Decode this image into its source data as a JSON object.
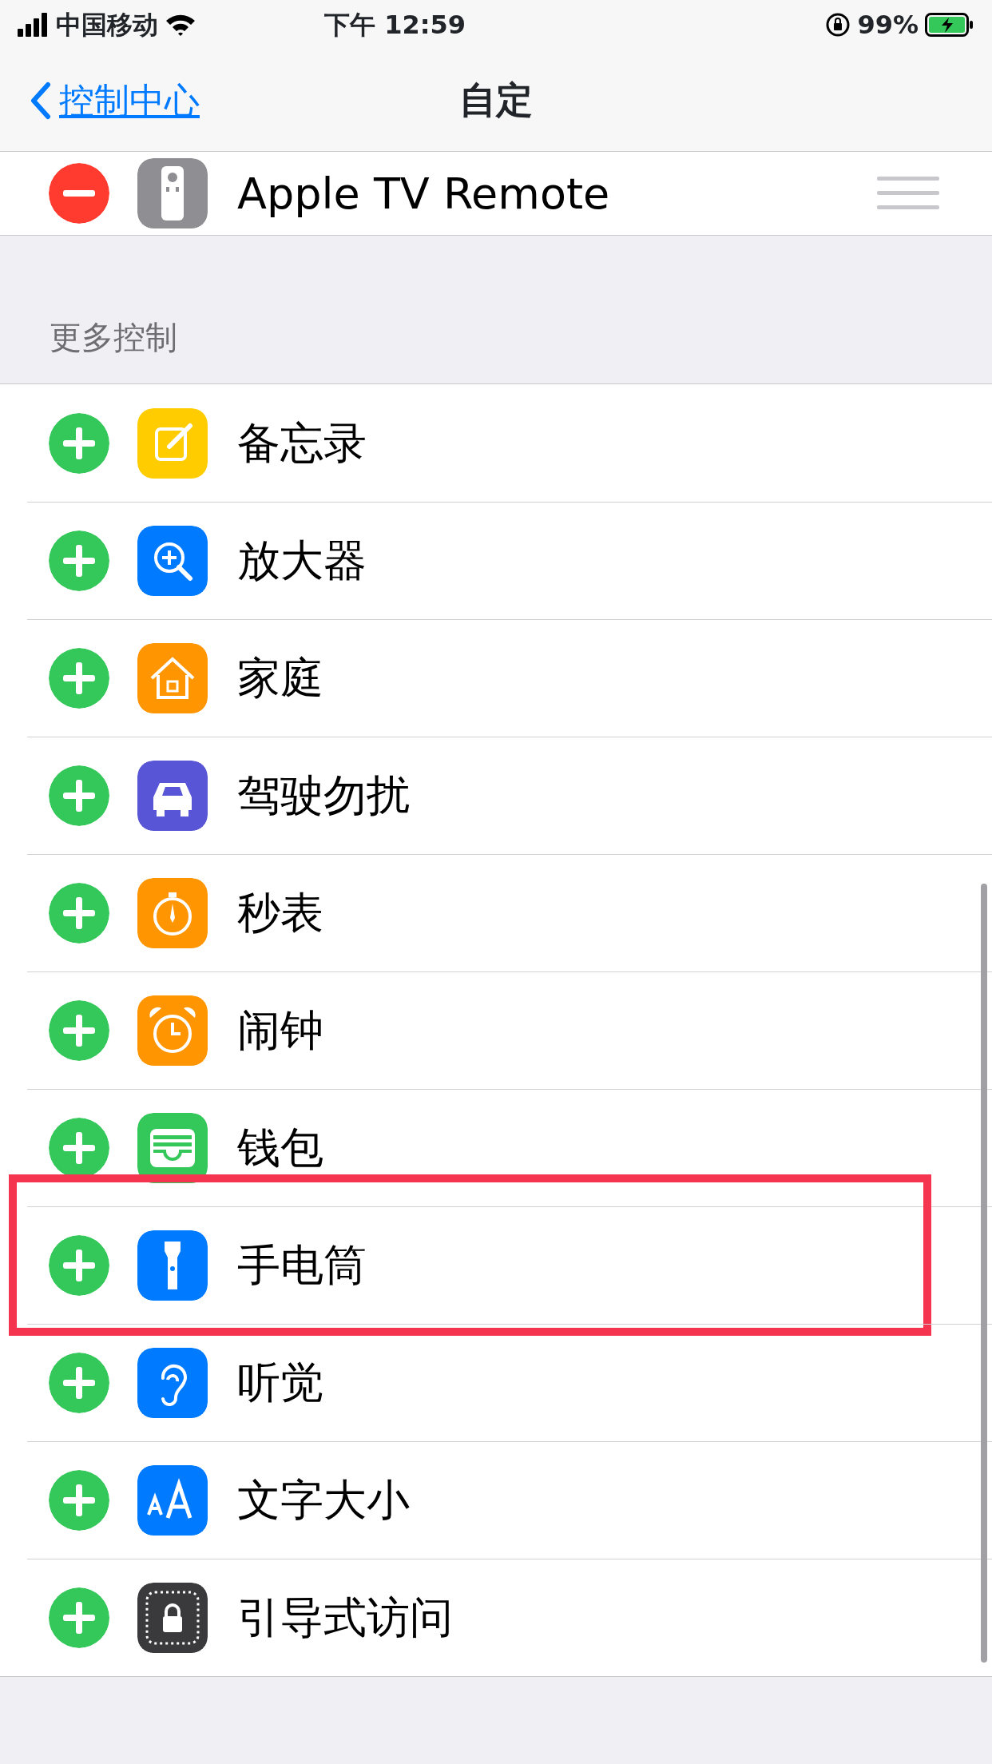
{
  "status_bar": {
    "carrier": "中国移动",
    "time": "下午 12:59",
    "battery": "99%"
  },
  "nav": {
    "back": "控制中心",
    "title": "自定"
  },
  "included": [
    {
      "label": "Apple TV Remote",
      "color": "#8e8e93"
    }
  ],
  "section_header": "更多控制",
  "more": [
    {
      "label": "备忘录",
      "color": "#ffcc00",
      "highlighted": false
    },
    {
      "label": "放大器",
      "color": "#007aff",
      "highlighted": false
    },
    {
      "label": "家庭",
      "color": "#ff9500",
      "highlighted": false
    },
    {
      "label": "驾驶勿扰",
      "color": "#5856d6",
      "highlighted": false
    },
    {
      "label": "秒表",
      "color": "#ff9500",
      "highlighted": false
    },
    {
      "label": "闹钟",
      "color": "#ff9500",
      "highlighted": false
    },
    {
      "label": "钱包",
      "color": "#34c759",
      "highlighted": false
    },
    {
      "label": "手电筒",
      "color": "#007aff",
      "highlighted": true
    },
    {
      "label": "听觉",
      "color": "#007aff",
      "highlighted": false
    },
    {
      "label": "文字大小",
      "color": "#007aff",
      "highlighted": false
    },
    {
      "label": "引导式访问",
      "color": "#3a3a3c",
      "highlighted": false
    }
  ]
}
